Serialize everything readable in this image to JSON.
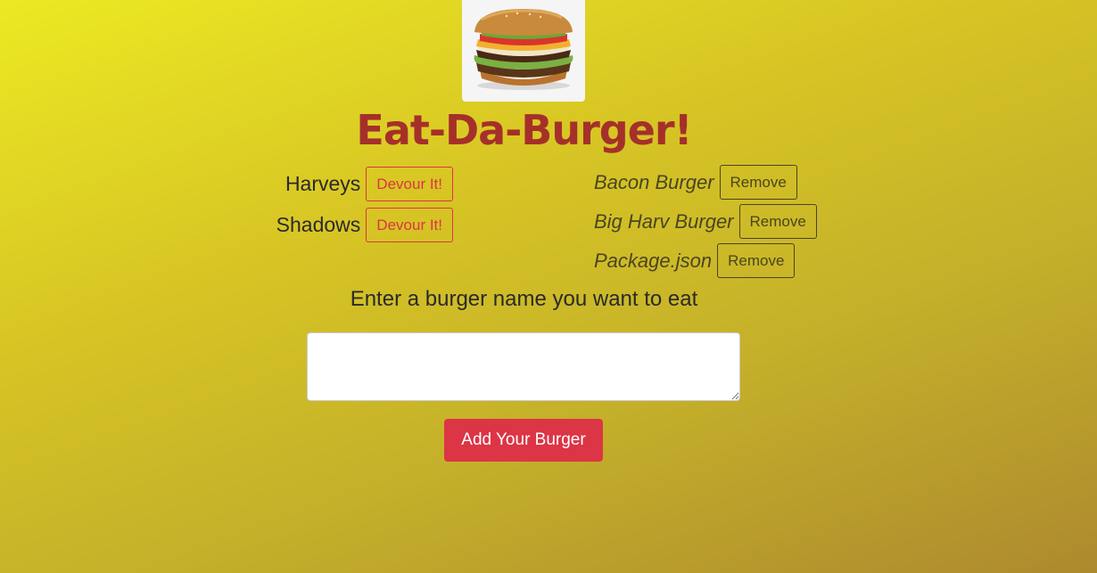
{
  "header": {
    "logo_icon": "burger-image",
    "title": "Eat-Da-Burger!"
  },
  "uneaten": [
    {
      "name": "Harveys",
      "button_label": "Devour It!"
    },
    {
      "name": "Shadows",
      "button_label": "Devour It!"
    }
  ],
  "eaten": [
    {
      "name": "Bacon Burger",
      "button_label": "Remove"
    },
    {
      "name": "Big Harv Burger",
      "button_label": "Remove"
    },
    {
      "name": "Package.json",
      "button_label": "Remove"
    }
  ],
  "form": {
    "label": "Enter a burger name you want to eat",
    "input_value": "",
    "submit_label": "Add Your Burger"
  },
  "colors": {
    "title": "#a5302a",
    "danger": "#dc3545",
    "background_start": "#ece923",
    "background_end": "#ad8a2e"
  }
}
